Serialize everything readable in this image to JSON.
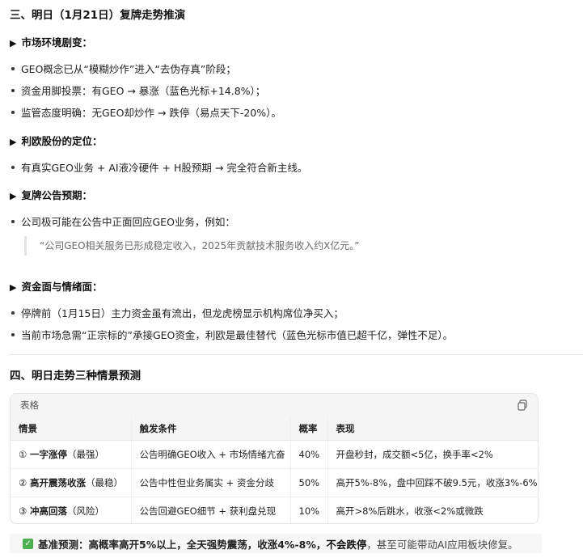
{
  "section3": {
    "title": "三、明日（1月21日）复牌走势推演",
    "market": {
      "heading": "市场环境剧变：",
      "items": [
        "GEO概念已从“模糊炒作”进入“去伪存真”阶段；",
        "资金用脚投票：有GEO → 暴涨（蓝色光标+14.8%）；",
        "监管态度明确：无GEO却炒作 → 跌停（易点天下-20%）。"
      ]
    },
    "position": {
      "heading": "利欧股份的定位：",
      "items": [
        "有真实GEO业务 + AI液冷硬件 + H股预期 → 完全符合新主线。"
      ]
    },
    "announcement": {
      "heading": "复牌公告预期：",
      "items": [
        "公司极可能在公告中正面回应GEO业务，例如："
      ],
      "quote": "“公司GEO相关服务已形成稳定收入，2025年贡献技术服务收入约X亿元。”"
    },
    "funds": {
      "heading": "资金面与情绪面：",
      "items": [
        "停牌前（1月15日）主力资金虽有流出，但龙虎榜显示机构席位净买入；",
        "当前市场急需“正宗标的”承接GEO资金，利欧是最佳替代（蓝色光标市值已超千亿，弹性不足）。"
      ]
    }
  },
  "section4": {
    "title": "四、明日走势三种情景预测",
    "table": {
      "label": "表格",
      "headers": [
        "情景",
        "触发条件",
        "概率",
        "表现"
      ],
      "rows": [
        {
          "num": "①",
          "name": "一字涨停",
          "tag": "（最强）",
          "cond": "公告明确GEO收入 + 市场情绪亢奋",
          "prob": "40%",
          "perf": "开盘秒封，成交额<5亿，换手率<2%"
        },
        {
          "num": "②",
          "name": "高开震荡收涨",
          "tag": "（最稳）",
          "cond": "公告中性但业务属实 + 资金分歧",
          "prob": "50%",
          "perf": "高开5%-8%，盘中回踩不破9.5元，收涨3%-6%"
        },
        {
          "num": "③",
          "name": "冲高回落",
          "tag": "（风险）",
          "cond": "公告回避GEO细节 + 获利盘兑现",
          "prob": "10%",
          "perf": "高开>8%后跳水，收涨<2%或微跌"
        }
      ]
    },
    "note": {
      "label": "基准预测：",
      "bold1": "高概率高开5%以上，全天强势震荡，收涨4%-8%，",
      "bold2": "不会跌停",
      "rest": "，甚至可能带动AI应用板块修复。"
    }
  }
}
